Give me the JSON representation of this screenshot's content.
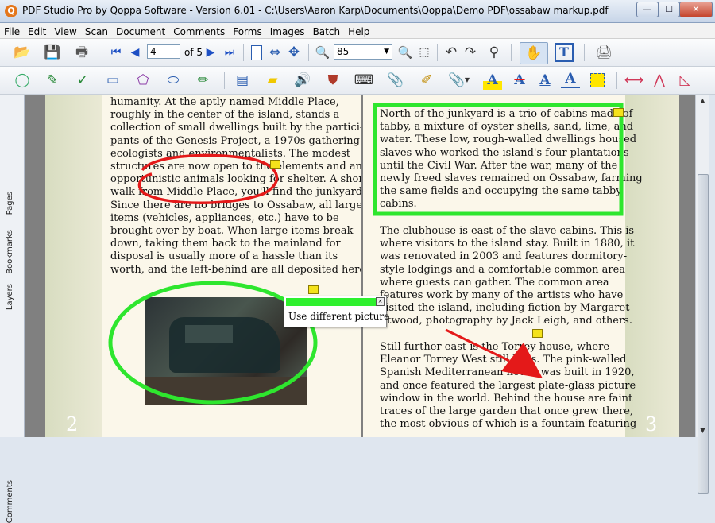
{
  "window": {
    "title": "PDF Studio Pro by Qoppa Software - Version 6.01 - C:\\Users\\Aaron Karp\\Documents\\Qoppa\\Demo PDF\\ossabaw markup.pdf",
    "app_icon_letter": "Q",
    "minimize": "—",
    "maximize": "☐",
    "close": "✕"
  },
  "menu": [
    "File",
    "Edit",
    "View",
    "Scan",
    "Document",
    "Comments",
    "Forms",
    "Images",
    "Batch",
    "Help"
  ],
  "toolbar": {
    "page_current": "4",
    "page_total_label": "of 5",
    "zoom_value": "85"
  },
  "side_tabs": [
    "Pages",
    "Bookmarks",
    "Layers",
    "Comments"
  ],
  "page2": {
    "number": "2",
    "lines": [
      "humanity. At the aptly named Middle Place,",
      "roughly in the center of the island, stands a",
      "collection of small dwellings built by the partici-",
      "pants of the Genesis Project, a 1970s gathering of",
      "ecologists and environmentalists. The modest",
      "structures are now open to the elements and any",
      "opportunistic animals looking for shelter. A short",
      "walk from Middle Place, you'll find the junkyard.",
      "Since there are no bridges to Ossabaw, all large",
      "items (vehicles, appliances, etc.) have to be",
      "brought over by boat. When large items break",
      "down, taking them back to the mainland for",
      "disposal is usually more of a hassle than its",
      "worth, and the left-behind are all deposited here."
    ]
  },
  "page3": {
    "number": "3",
    "para1": [
      "North of the junkyard is a trio of cabins made of",
      "tabby, a mixture of oyster shells, sand, lime, and",
      "water. These low, rough-walled dwellings housed",
      "slaves who worked the island's four plantations",
      "until the Civil War. After the war, many of the",
      "newly freed slaves remained on Ossabaw, farming",
      "the same fields and occupying the same tabby",
      "cabins."
    ],
    "para2": [
      "The clubhouse is east of the slave cabins. This is",
      "where visitors to the island stay. Built in 1880, it",
      "was renovated in 2003 and features dormitory-",
      "style lodgings and a comfortable common area",
      "where guests can gather. The common area",
      "features work by many of the artists who have",
      "visited the island, including fiction by Margaret",
      "Atwood, photography by Jack Leigh, and others."
    ],
    "para3": [
      "Still further east is the Torrey house, where",
      "Eleanor Torrey West still lives. The pink-walled",
      "Spanish Mediterranean house was built in 1920,",
      "and once featured the largest plate-glass picture",
      "window in the world. Behind the house are faint",
      "traces of the large garden that once grew there,",
      "the most obvious of which is a fountain featuring"
    ]
  },
  "popup": {
    "text": "Use different picture",
    "close": "×"
  },
  "colors": {
    "markup_red": "#e41919",
    "markup_green": "#22e622",
    "note_yellow": "#f4e21b"
  }
}
